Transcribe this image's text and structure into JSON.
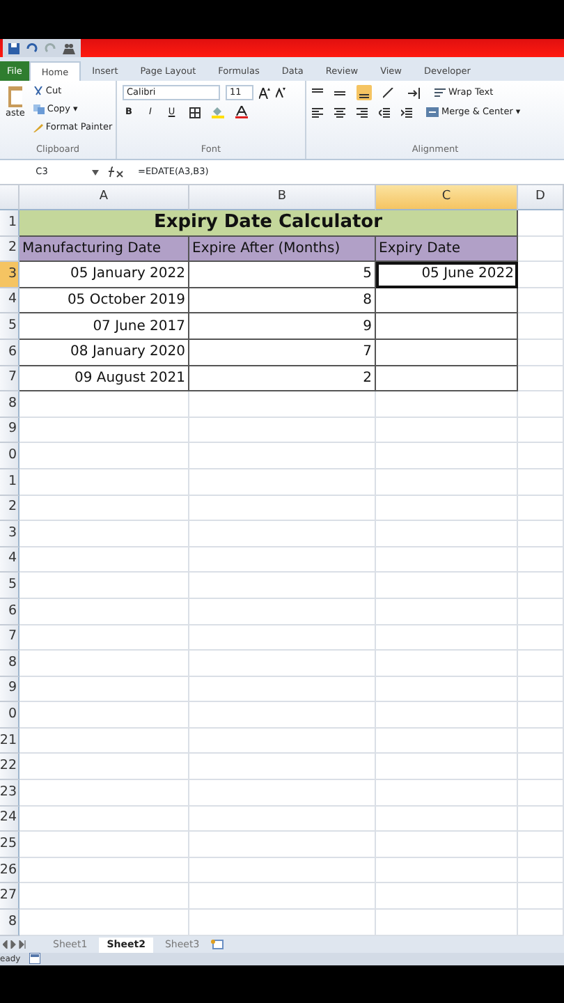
{
  "ribbon_tabs": [
    {
      "label": "File",
      "kind": "file",
      "selected": false
    },
    {
      "label": "Home",
      "kind": "tab",
      "selected": true
    },
    {
      "label": "Insert",
      "kind": "tab",
      "selected": false
    },
    {
      "label": "Page Layout",
      "kind": "tab",
      "selected": false
    },
    {
      "label": "Formulas",
      "kind": "tab",
      "selected": false
    },
    {
      "label": "Data",
      "kind": "tab",
      "selected": false
    },
    {
      "label": "Review",
      "kind": "tab",
      "selected": false
    },
    {
      "label": "View",
      "kind": "tab",
      "selected": false
    },
    {
      "label": "Developer",
      "kind": "tab",
      "selected": false
    }
  ],
  "clipboard": {
    "paste": "aste",
    "cut": "Cut",
    "copy": "Copy ▾",
    "format_painter": "Format Painter",
    "group": "Clipboard"
  },
  "font": {
    "name": "Calibri",
    "size": "11",
    "bold": "B",
    "italic": "I",
    "underline": "U",
    "group": "Font"
  },
  "alignment": {
    "wrap": "Wrap Text",
    "merge": "Merge & Center ▾",
    "group": "Alignment"
  },
  "formula_bar": {
    "cell": "C3",
    "formula": "=EDATE(A3,B3)"
  },
  "columns": [
    {
      "label": "A",
      "selected": false
    },
    {
      "label": "B",
      "selected": false
    },
    {
      "label": "C",
      "selected": true
    },
    {
      "label": "D",
      "selected": false
    }
  ],
  "row_headers": [
    {
      "label": "1",
      "selected": false
    },
    {
      "label": "2",
      "selected": false
    },
    {
      "label": "3",
      "selected": true
    },
    {
      "label": "4",
      "selected": false
    },
    {
      "label": "5",
      "selected": false
    },
    {
      "label": "6",
      "selected": false
    },
    {
      "label": "7",
      "selected": false
    },
    {
      "label": "8",
      "selected": false
    },
    {
      "label": "9",
      "selected": false
    },
    {
      "label": "0",
      "selected": false
    },
    {
      "label": "1",
      "selected": false
    },
    {
      "label": "2",
      "selected": false
    },
    {
      "label": "3",
      "selected": false
    },
    {
      "label": "4",
      "selected": false
    },
    {
      "label": "5",
      "selected": false
    },
    {
      "label": "6",
      "selected": false
    },
    {
      "label": "7",
      "selected": false
    },
    {
      "label": "8",
      "selected": false
    },
    {
      "label": "9",
      "selected": false
    },
    {
      "label": "0",
      "selected": false
    },
    {
      "label": "21",
      "selected": false
    },
    {
      "label": "22",
      "selected": false
    },
    {
      "label": "23",
      "selected": false
    },
    {
      "label": "24",
      "selected": false
    },
    {
      "label": "25",
      "selected": false
    },
    {
      "label": "26",
      "selected": false
    },
    {
      "label": "27",
      "selected": false
    },
    {
      "label": "8",
      "selected": false
    }
  ],
  "title": "Expiry Date Calculator",
  "headers": [
    "Manufacturing Date",
    "Expire After (Months)",
    "Expiry Date"
  ],
  "data_rows": [
    {
      "manufacturing_date": "05 January 2022",
      "months": "5",
      "expiry_date": "05 June 2022",
      "selected": true
    },
    {
      "manufacturing_date": "05 October 2019",
      "months": "8",
      "selected": false
    },
    {
      "manufacturing_date": "07 June 2017",
      "months": "9",
      "selected": false
    },
    {
      "manufacturing_date": "08 January 2020",
      "months": "7",
      "selected": false
    },
    {
      "manufacturing_date": "09 August 2021",
      "months": "2",
      "selected": false
    }
  ],
  "sheet_tabs": [
    {
      "label": "Sheet1",
      "selected": false
    },
    {
      "label": "Sheet2",
      "selected": true
    },
    {
      "label": "Sheet3",
      "selected": false
    }
  ],
  "status": "eady"
}
